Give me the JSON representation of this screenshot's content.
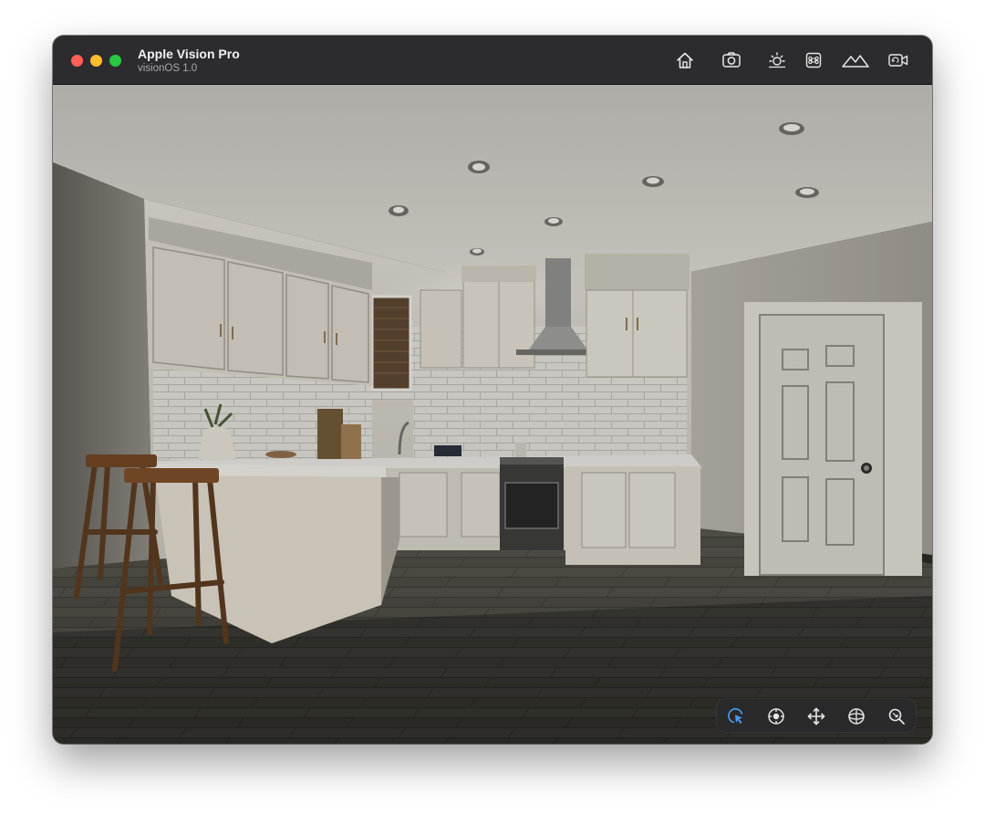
{
  "window": {
    "title": "Apple Vision Pro",
    "subtitle": "visionOS 1.0"
  },
  "toolbar": {
    "buttons": [
      {
        "icon": "home-icon"
      },
      {
        "icon": "camera-icon"
      },
      {
        "icon": "brightness-icon"
      },
      {
        "icon": "command-key-icon"
      },
      {
        "icon": "mountains-icon"
      },
      {
        "icon": "video-rotate-icon"
      }
    ]
  },
  "ornament": {
    "buttons": [
      {
        "icon": "pointer-icon",
        "active": true
      },
      {
        "icon": "look-around-icon",
        "active": false
      },
      {
        "icon": "pan-move-icon",
        "active": false
      },
      {
        "icon": "orbit-icon",
        "active": false
      },
      {
        "icon": "zoom-icon",
        "active": false
      }
    ]
  },
  "colors": {
    "accent": "#4a9df0",
    "close": "#ff5f57",
    "minimize": "#febc2e",
    "maximize": "#28c840"
  },
  "scene": {
    "environment": "kitchen"
  }
}
